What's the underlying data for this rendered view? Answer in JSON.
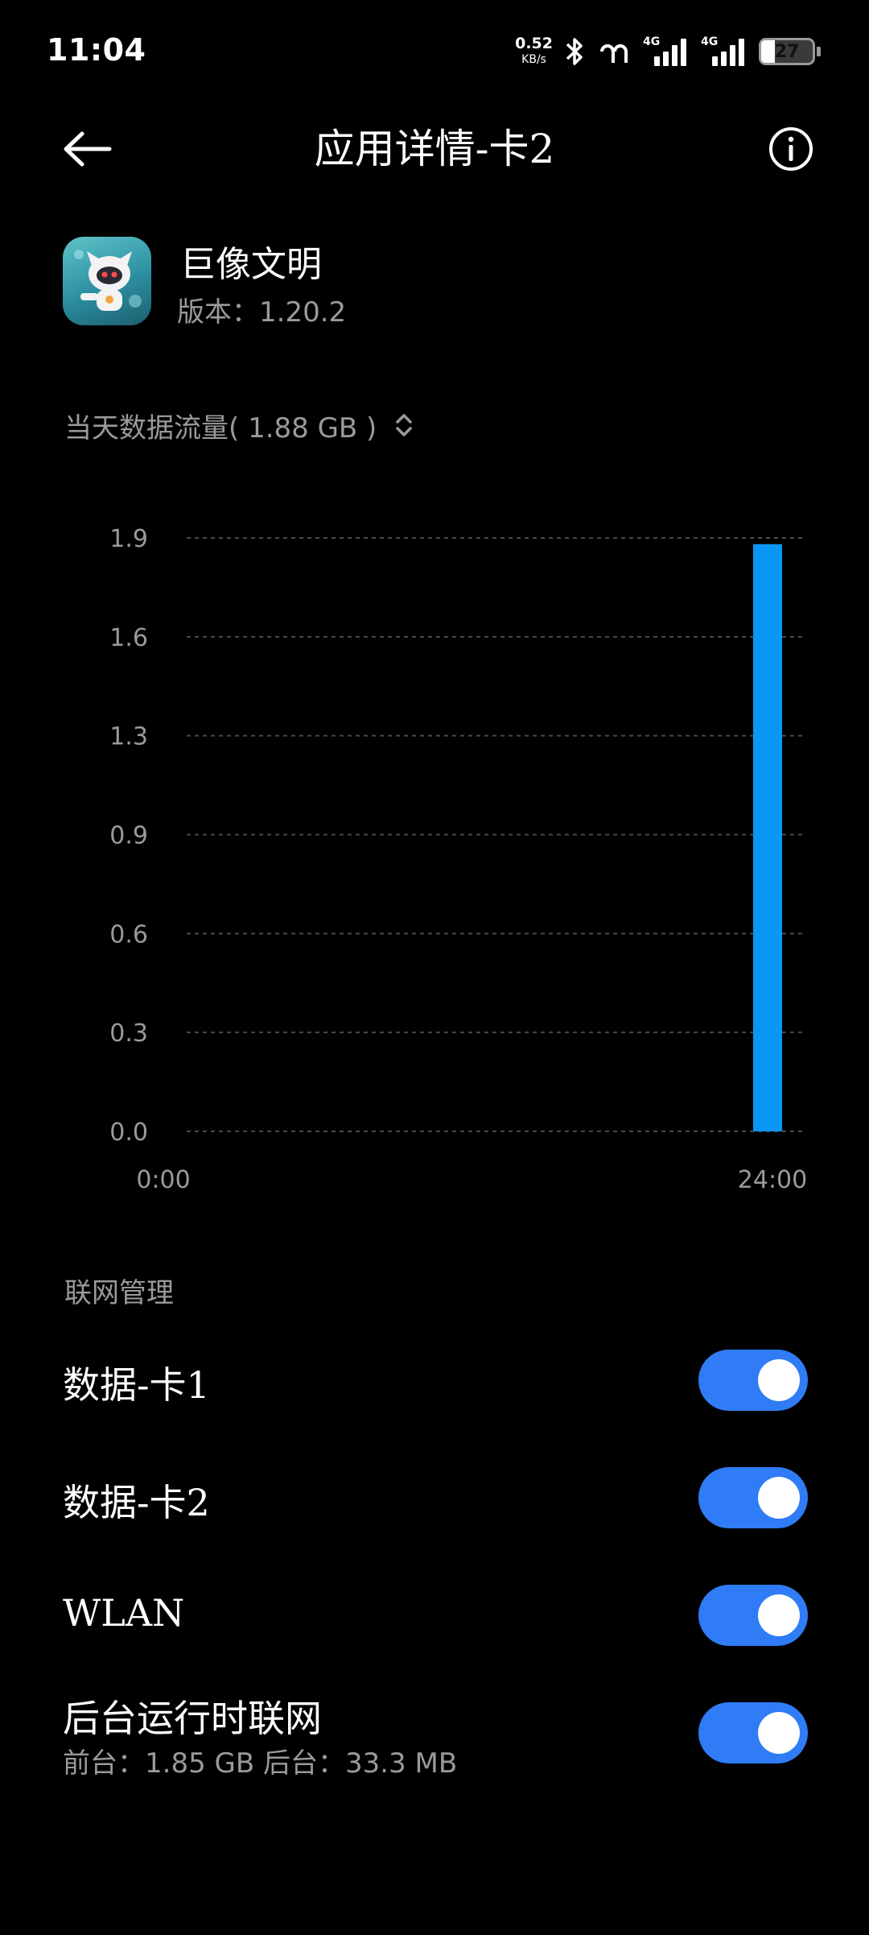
{
  "status_bar": {
    "time": "11:04",
    "net_speed_value": "0.52",
    "net_speed_unit": "KB/s",
    "sim1_tag": "4G",
    "sim2_tag": "4G",
    "battery": "27",
    "icons": [
      "bluetooth-icon",
      "earbuds-icon",
      "signal-icon",
      "battery-icon"
    ]
  },
  "header": {
    "title": "应用详情-卡2",
    "back_icon": "arrow-left-icon",
    "info_icon": "info-icon"
  },
  "app": {
    "name": "巨像文明",
    "version": "版本：1.20.2"
  },
  "usage": {
    "label": "当天数据流量( 1.88 GB )",
    "selector_icon": "up-down-chevron-icon"
  },
  "chart_data": {
    "type": "bar",
    "x_labels": [
      "0:00",
      "24:00"
    ],
    "ylim": [
      0,
      1.9
    ],
    "y_ticks": [
      "1.9",
      "1.6",
      "1.3",
      "0.9",
      "0.6",
      "0.3",
      "0.0"
    ],
    "grid": true,
    "bar_color": "#0a96f5",
    "bars": [
      {
        "x": "24:00",
        "value": 1.88
      }
    ]
  },
  "network_section": {
    "title": "联网管理",
    "items": [
      {
        "label": "数据-卡1",
        "enabled": true
      },
      {
        "label": "数据-卡2",
        "enabled": true
      },
      {
        "label": "WLAN",
        "enabled": true
      },
      {
        "label": "后台运行时联网",
        "sublabel": "前台：1.85 GB   后台：33.3 MB",
        "enabled": true
      }
    ]
  },
  "colors": {
    "accent": "#2f7cf6",
    "bar": "#0a96f5",
    "secondary_text": "#9a9a9a"
  }
}
